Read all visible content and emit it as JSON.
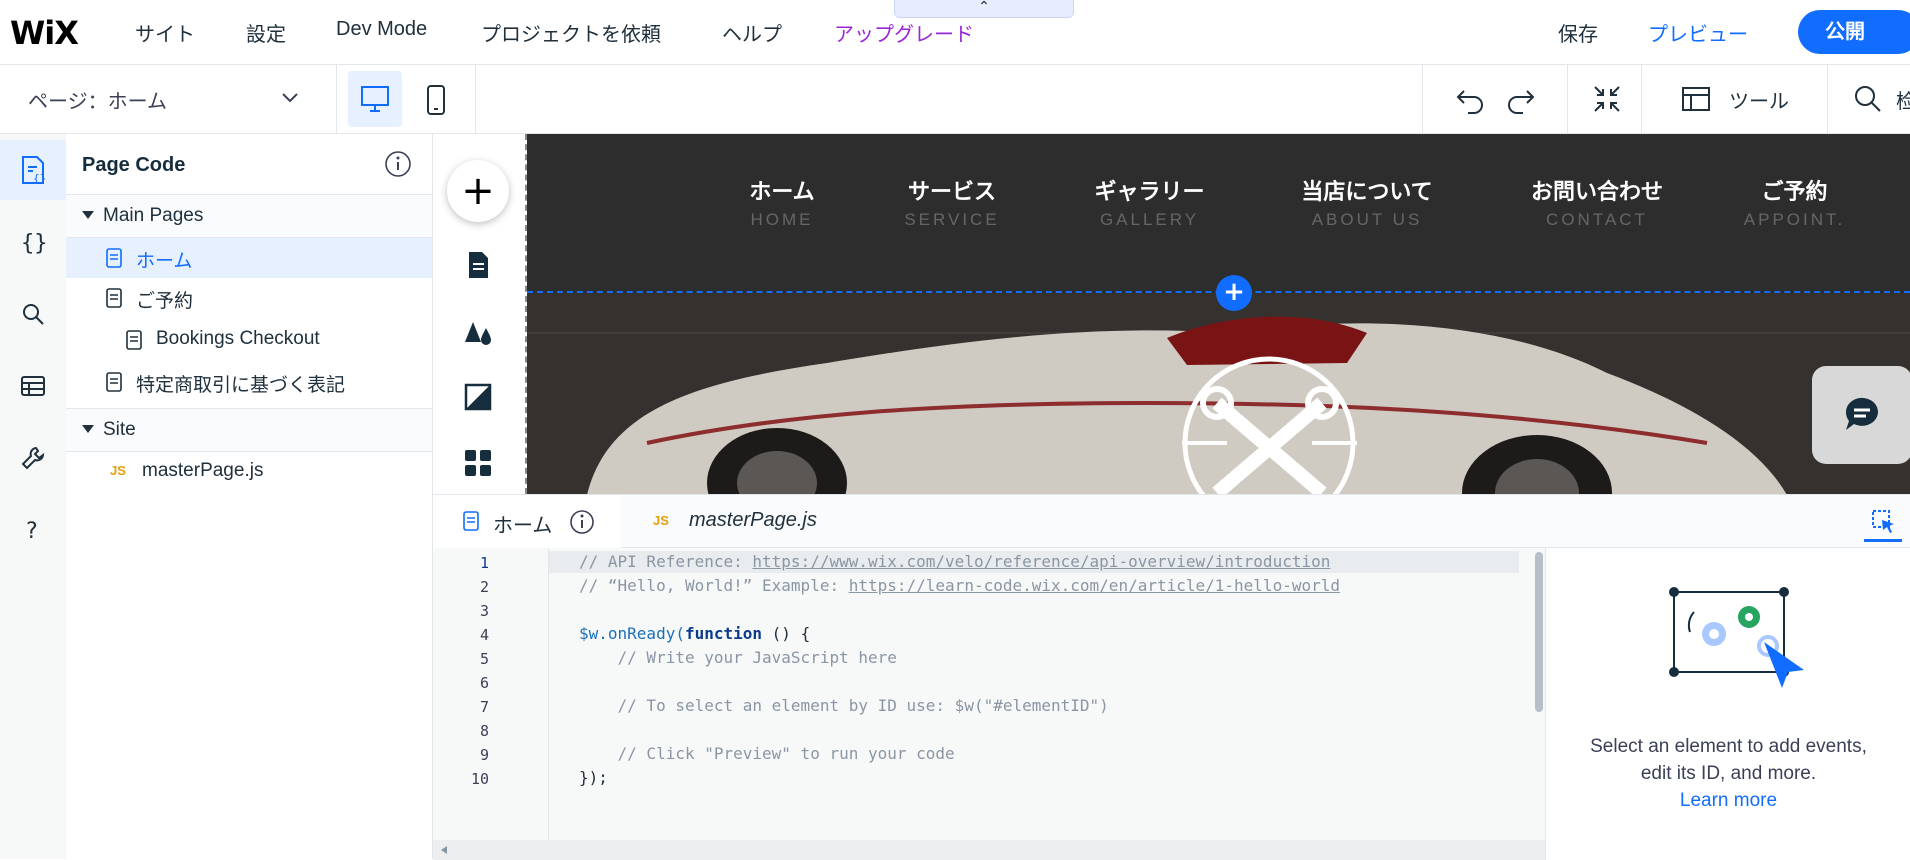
{
  "topbar": {
    "logo": "WiX",
    "menu": [
      "サイト",
      "設定",
      "Dev Mode",
      "プロジェクトを依頼",
      "ヘルプ",
      "アップグレード"
    ],
    "save": "保存",
    "preview": "プレビュー",
    "publish": "公開",
    "handle_glyph": "⌃"
  },
  "secondbar": {
    "page_selector": "ページ：ホーム",
    "tools": "ツール",
    "search_partial": "检"
  },
  "panel": {
    "title": "Page Code",
    "main_pages_header": "Main Pages",
    "main_pages": [
      {
        "label": "ホーム"
      },
      {
        "label": "ご予約"
      },
      {
        "label": "Bookings Checkout"
      },
      {
        "label": "特定商取引に基づく表記"
      }
    ],
    "site_header": "Site",
    "site_files": [
      {
        "icon": "JS",
        "label": "masterPage.js"
      }
    ]
  },
  "site_nav": [
    {
      "jp": "ホーム",
      "en": "HOME"
    },
    {
      "jp": "サービス",
      "en": "SERVICE"
    },
    {
      "jp": "ギャラリー",
      "en": "GALLERY"
    },
    {
      "jp": "当店について",
      "en": "ABOUT US"
    },
    {
      "jp": "お問い合わせ",
      "en": "CONTACT"
    },
    {
      "jp": "ご予約",
      "en": "APPOINT."
    }
  ],
  "codepanel": {
    "tab1": "ホーム",
    "tab2": "masterPage.js",
    "tab2_icon": "JS",
    "line_numbers": [
      "1",
      "2",
      "3",
      "4",
      "5",
      "6",
      "7",
      "8",
      "9",
      "10"
    ],
    "code": {
      "l1_prefix": "// API Reference: ",
      "l1_link": "https://www.wix.com/velo/reference/api-overview/introduction",
      "l2_prefix": "// “Hello, World!” Example: ",
      "l2_link": "https://learn-code.wix.com/en/article/1-hello-world",
      "l4_a": "$w",
      "l4_b": ".onReady(",
      "l4_kw": "function",
      "l4_c": " () {",
      "l5": "    // Write your JavaScript here",
      "l7": "    // To select an element by ID use: $w(\"#elementID\")",
      "l9": "    // Click \"Preview\" to run your code",
      "l10": "});"
    },
    "side_text_line1": "Select an element to add events,",
    "side_text_line2": "edit its ID, and more.",
    "learn_more": "Learn more"
  },
  "colors": {
    "accent": "#116dff",
    "upgrade": "#9a27d5",
    "site_bg": "#2d2d2d"
  }
}
